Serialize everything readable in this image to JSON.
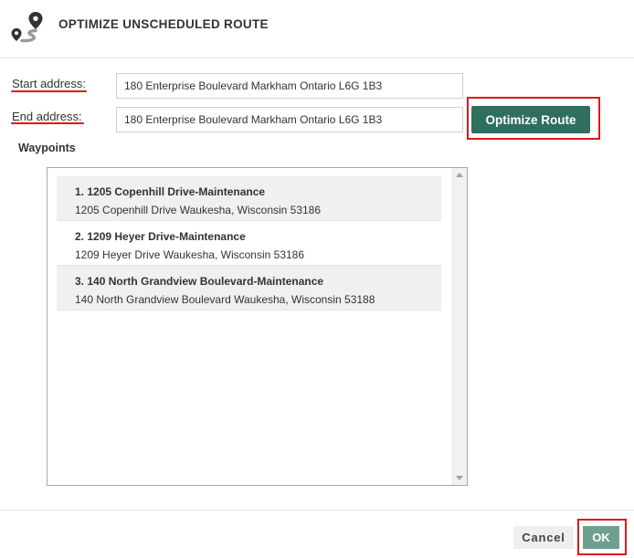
{
  "dialog": {
    "title": "OPTIMIZE UNSCHEDULED ROUTE",
    "logo_icon": "route-map-pin-icon"
  },
  "form": {
    "start_label": "Start address:",
    "start_value": "180 Enterprise Boulevard Markham Ontario L6G 1B3",
    "end_label": "End address:",
    "end_value": "180 Enterprise Boulevard Markham Ontario L6G 1B3",
    "optimize_label": "Optimize Route"
  },
  "waypoints": {
    "label": "Waypoints",
    "items": [
      {
        "name": "1. 1205 Copenhill Drive-Maintenance",
        "address": "1205 Copenhill Drive Waukesha, Wisconsin 53186"
      },
      {
        "name": "2. 1209 Heyer Drive-Maintenance",
        "address": "1209 Heyer Drive Waukesha, Wisconsin 53186"
      },
      {
        "name": "3. 140 North Grandview Boulevard-Maintenance",
        "address": "140 North Grandview Boulevard Waukesha, Wisconsin 53188"
      }
    ]
  },
  "footer": {
    "cancel_label": "Cancel",
    "ok_label": "OK"
  },
  "colors": {
    "primary": "#2e6f5e",
    "ok_button": "#6fa08f",
    "highlight": "#e01818"
  }
}
